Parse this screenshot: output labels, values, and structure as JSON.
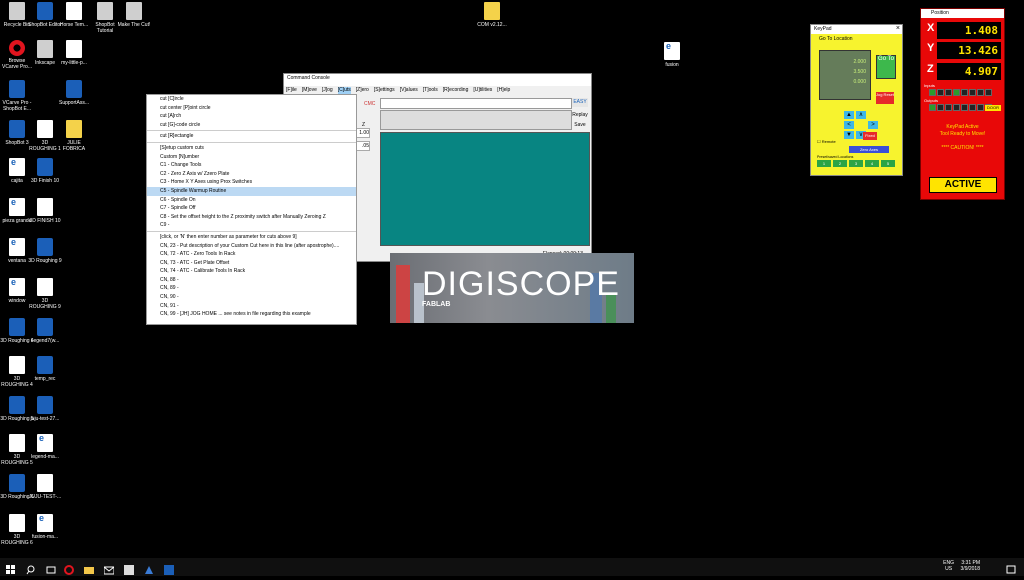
{
  "desktop_icons": [
    {
      "label": "Recycle Bin",
      "icon": "recycle-bin-icon",
      "kind": "grey"
    },
    {
      "label": "ShopBot Editor",
      "icon": "shopbot-editor-icon",
      "kind": "blue"
    },
    {
      "label": "Horse Tem...",
      "icon": "image-file-icon",
      "kind": "doc"
    },
    {
      "label": "ShopBot Tutorial",
      "icon": "shopbot-tutorial-icon",
      "kind": "grey"
    },
    {
      "label": "Make The Cut!",
      "icon": "make-the-cut-icon",
      "kind": "grey"
    },
    {
      "label": "Browse VCarve Pro...",
      "icon": "opera-browser-icon",
      "kind": "red"
    },
    {
      "label": "Inkscape",
      "icon": "inkscape-icon",
      "kind": "grey"
    },
    {
      "label": "my-little-p...",
      "icon": "file-icon",
      "kind": "doc"
    },
    {
      "label": "VCarve Pro - ShopBot E...",
      "icon": "vcarve-icon",
      "kind": "blue"
    },
    {
      "label": "SupportAss...",
      "icon": "support-assist-icon",
      "kind": "blue"
    },
    {
      "label": "ShopBot 3",
      "icon": "shopbot3-icon",
      "kind": "blue"
    },
    {
      "label": "3D ROUGHING 1",
      "icon": "document-icon",
      "kind": "doc"
    },
    {
      "label": "JULIE FOBRICA",
      "icon": "document-icon",
      "kind": "yellow"
    },
    {
      "label": "cajita",
      "icon": "pdf-icon",
      "kind": "pdf"
    },
    {
      "label": "3D Finish 10",
      "icon": "shopbot-file-icon",
      "kind": "blue"
    },
    {
      "label": "pieza grande",
      "icon": "pdf-icon",
      "kind": "pdf"
    },
    {
      "label": "3D FINISH 10",
      "icon": "document-icon",
      "kind": "doc"
    },
    {
      "label": "ventana",
      "icon": "pdf-icon",
      "kind": "pdf"
    },
    {
      "label": "3D Roughing 9",
      "icon": "shopbot-file-icon",
      "kind": "blue"
    },
    {
      "label": "window",
      "icon": "pdf-icon",
      "kind": "pdf"
    },
    {
      "label": "3D ROUGHING 9",
      "icon": "document-icon",
      "kind": "doc"
    },
    {
      "label": "3D Roughing 4",
      "icon": "shopbot-file-icon",
      "kind": "blue"
    },
    {
      "label": "Legend7(w...",
      "icon": "legend-file-icon",
      "kind": "blue"
    },
    {
      "label": "3D ROUGHING 4",
      "icon": "document-icon",
      "kind": "doc"
    },
    {
      "label": "temp_rec",
      "icon": "shopbot-file-icon",
      "kind": "blue"
    },
    {
      "label": "3D Roughing 5",
      "icon": "shopbot-file-icon",
      "kind": "blue"
    },
    {
      "label": "juju-test-27...",
      "icon": "shopbot-file-icon",
      "kind": "blue"
    },
    {
      "label": "3D ROUGHING 5",
      "icon": "document-icon",
      "kind": "doc"
    },
    {
      "label": "legend-ma...",
      "icon": "pdf-icon",
      "kind": "pdf"
    },
    {
      "label": "3D Roughing 6",
      "icon": "shopbot-file-icon",
      "kind": "blue"
    },
    {
      "label": "JUJU-TEST-...",
      "icon": "document-icon",
      "kind": "doc"
    },
    {
      "label": "3D ROUGHING 6",
      "icon": "document-icon",
      "kind": "doc"
    },
    {
      "label": "fusion-ma...",
      "icon": "pdf-icon",
      "kind": "pdf"
    },
    {
      "label": "COM v2.12...",
      "icon": "folder-icon",
      "kind": "yellow"
    },
    {
      "label": "fusion",
      "icon": "pdf-icon",
      "kind": "pdf"
    }
  ],
  "console": {
    "title": "Command Console",
    "menu": [
      "[F]ile",
      "[M]ove",
      "[J]og",
      "[C]uts",
      "[Z]ero",
      "[S]ettings",
      "[V]alues",
      "[T]ools",
      "[R]ecording",
      "[U]tilities",
      "[H]elp"
    ],
    "easy": "EASY",
    "replay": "Replay",
    "save": "Save",
    "cmcl": "CMC",
    "z_label": "Z",
    "field1": "1.00",
    "field2": ".05",
    "elapsed": "Elapsed: 00:09:13"
  },
  "cuts_menu": {
    "items": [
      "cut [C]ircle",
      "cut center [P]oint circle",
      "cut [A]rch",
      "cut [G]-code circle",
      "---",
      "cut [R]ectangle",
      "---",
      "[S]etup custom cuts",
      "Custom [N]umber",
      "C1  -  Change Tools",
      "C2  -  Zero Z Axis w/ Zzero Plate",
      "C3  -  Home X  Y Axes using Prox Switches",
      "C5  -  Spindle Warmup Routine",
      "C6  -  Spindle On",
      "C7  -  Spindle Off",
      "C8  -  Set the offset height to the Z proximity switch after Manually Zeroing Z",
      "C9  -",
      "---",
      "[click, or 'N' then enter number as parameter for cuts above 9]",
      "CN, 23  -  Put description of your Custom Cut here in this line (after apostrophe)....",
      "CN, 72  -  ATC - Zero Tools In Rack",
      "CN, 73  -  ATC - Get Plate Offset",
      "CN, 74  -  ATC - Calibrate Tools In Rack",
      "CN, 88  -",
      "CN, 89  -",
      "CN, 90  -",
      "CN, 91  -",
      "CN, 99  -  [JH] JOG HOME ... see notes in file regarding this example"
    ],
    "highlighted": "C5  -  Spindle Warmup Routine"
  },
  "banner": {
    "brand": "DIGISCOPE",
    "sub": "FABLAB"
  },
  "keypad": {
    "title": "KeyPad",
    "close": "×",
    "goto_label": "Go To Location",
    "lcd": [
      "2.000",
      "3.500",
      "0.000"
    ],
    "goto": "Go To",
    "jog": "Jog Reset",
    "fixed": "Fixed",
    "remote": "Remote",
    "zero_axes": "Zero Axes",
    "preset_label": "Preset/saved Locations",
    "presets": [
      "1",
      "2",
      "3",
      "4",
      "5"
    ]
  },
  "dro": {
    "title": "Position",
    "axes": [
      {
        "axis": "X",
        "value": "1.408"
      },
      {
        "axis": "Y",
        "value": "13.426"
      },
      {
        "axis": "Z",
        "value": "4.907"
      }
    ],
    "inputs": "Inputs",
    "outputs": "Outputs",
    "door": "DOOR",
    "status": [
      "KeyPad Active",
      "Tool Ready to Move!",
      "",
      "**** CAUTION! ****"
    ],
    "active": "ACTIVE"
  },
  "taskbar": {
    "lang": "ENG",
    "region": "US",
    "time": "3:31 PM",
    "date": "3/9/2018"
  },
  "colors": {
    "keypad_yellow": "#f7f32e",
    "dro_red": "#e80808",
    "teal": "#088582",
    "highlight": "#bcd9f3"
  }
}
